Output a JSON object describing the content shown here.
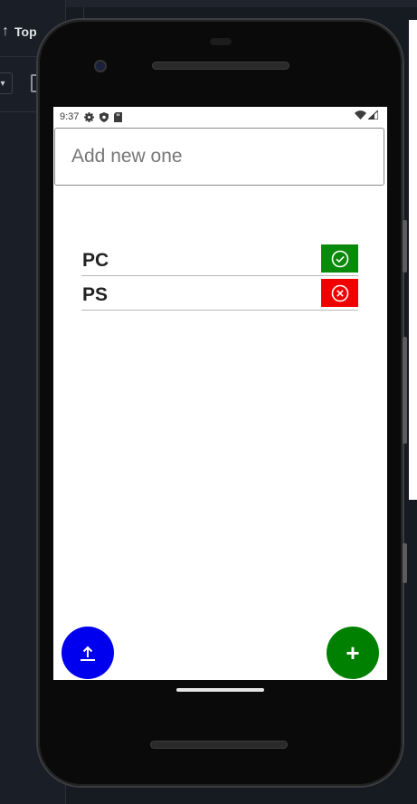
{
  "ide": {
    "top_button_label": "Top"
  },
  "statusbar": {
    "time": "9:37",
    "icons": [
      "settings-icon",
      "shield-icon",
      "sd-card-icon",
      "wifi-icon",
      "signal-icon"
    ]
  },
  "input": {
    "placeholder": "Add new one",
    "value": ""
  },
  "items": [
    {
      "label": "PC",
      "status": "done",
      "button_icon": "check-circle-icon",
      "button_color": "#0a8a0a"
    },
    {
      "label": "PS",
      "status": "not-done",
      "button_icon": "x-circle-icon",
      "button_color": "#f20000"
    }
  ],
  "fabs": {
    "upload": {
      "icon": "upload-icon",
      "color": "#0000ee"
    },
    "add": {
      "label": "+",
      "icon": "plus-icon",
      "color": "#008000"
    }
  },
  "colors": {
    "accent_blue": "#0000ee",
    "accent_green": "#008000",
    "done_green": "#0a8a0a",
    "error_red": "#f20000"
  }
}
